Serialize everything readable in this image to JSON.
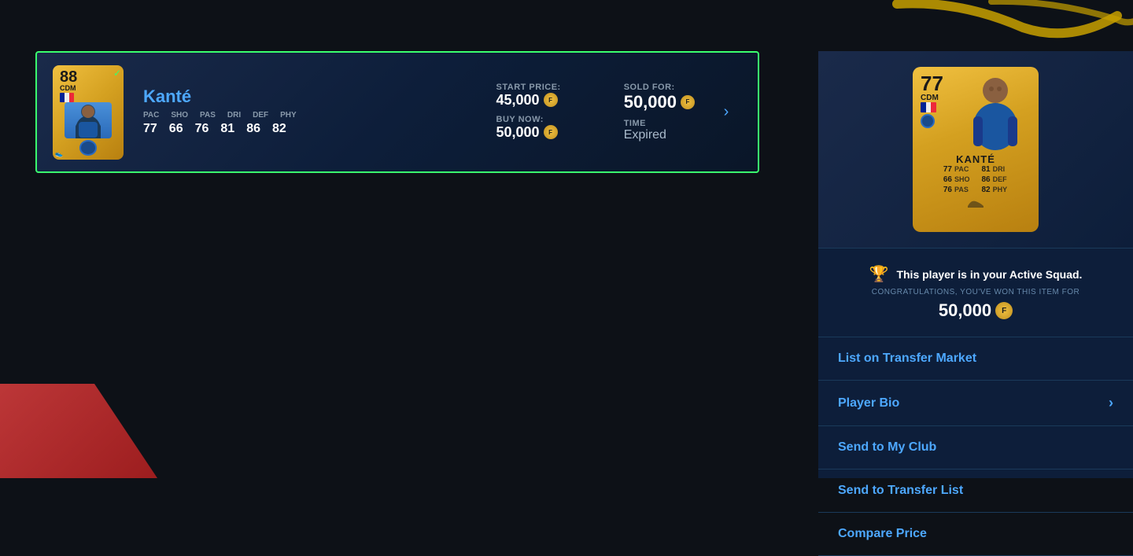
{
  "player": {
    "name": "Kanté",
    "rating": "88",
    "position": "CDM",
    "stats": {
      "pac": "77",
      "sho": "66",
      "pas": "76",
      "dri": "81",
      "def": "86",
      "phy": "82"
    },
    "labels": {
      "pac": "PAC",
      "sho": "SHO",
      "pas": "PAS",
      "dri": "DRI",
      "def": "DEF",
      "phy": "PHY"
    }
  },
  "listing": {
    "start_price_label": "START PRICE:",
    "start_price": "45,000",
    "buy_now_label": "BUY NOW:",
    "buy_now": "50,000",
    "sold_for_label": "SOLD FOR:",
    "sold_for": "50,000",
    "time_label": "TIME",
    "time_value": "Expired"
  },
  "notification": {
    "icon": "🏆",
    "main_text": "This player is in your Active Squad.",
    "sub_text": "CONGRATULATIONS, YOU'VE WON THIS ITEM FOR",
    "price": "50,000"
  },
  "actions": {
    "list_on_market": "List on Transfer Market",
    "player_bio": "Player Bio",
    "send_to_club": "Send to My Club",
    "send_to_transfer": "Send to Transfer List",
    "compare_price": "Compare Price"
  },
  "large_card": {
    "name": "KANTÉ",
    "rating": "77",
    "position": "CDM",
    "stats": {
      "pac_label": "PAC",
      "pac_val": "77",
      "dri_label": "DRI",
      "dri_val": "81",
      "sho_label": "SHO",
      "sho_val": "66",
      "def_label": "DEF",
      "def_val": "86",
      "pas_label": "PAS",
      "pas_val": "76",
      "phy_label": "PHY",
      "phy_val": "82"
    }
  }
}
